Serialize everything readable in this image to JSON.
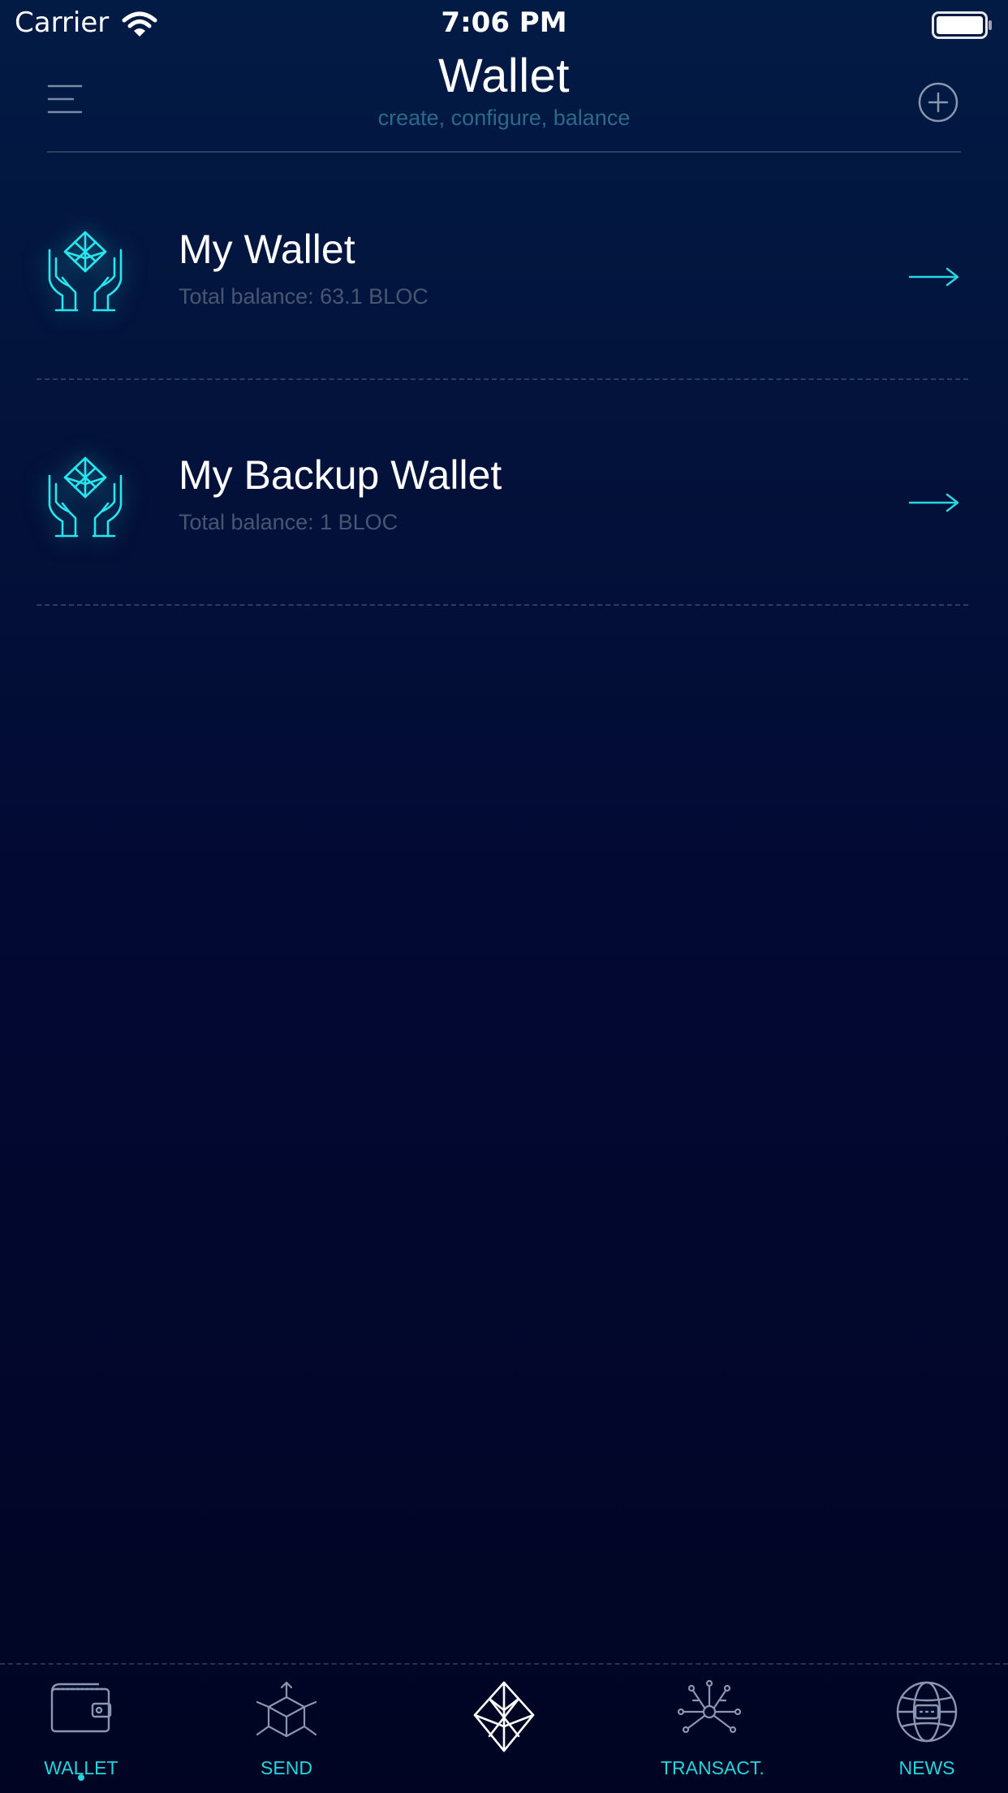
{
  "status_bar": {
    "carrier": "Carrier",
    "time": "7:06 PM"
  },
  "header": {
    "title": "Wallet",
    "subtitle": "create, configure, balance",
    "left_icon": "menu-icon",
    "right_icon": "plus-circle-icon"
  },
  "wallets": [
    {
      "name": "My Wallet",
      "balance": "Total balance: 63.1 BLOC",
      "icon": "hands-crystal-icon"
    },
    {
      "name": "My Backup Wallet",
      "balance": "Total balance: 1 BLOC",
      "icon": "hands-crystal-icon"
    }
  ],
  "tabs": [
    {
      "label": "WALLET",
      "icon": "wallet-icon",
      "active": true
    },
    {
      "label": "SEND",
      "icon": "send-cube-icon",
      "active": false
    },
    {
      "label": "",
      "icon": "crystal-logo-icon",
      "active": false
    },
    {
      "label": "TRANSACT.",
      "icon": "network-icon",
      "active": false
    },
    {
      "label": "NEWS",
      "icon": "globe-icon",
      "active": false
    }
  ],
  "colors": {
    "accent": "#22d6e0",
    "background_top": "#021b45",
    "background_bottom": "#010523",
    "subtitle": "#2a6a8a",
    "balance_text": "#475672"
  }
}
